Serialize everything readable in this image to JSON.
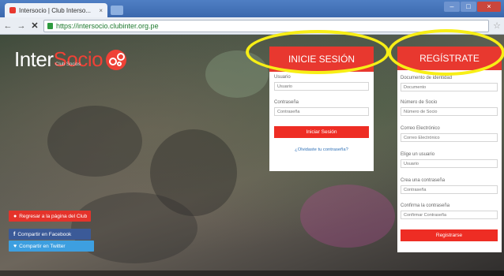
{
  "browser": {
    "tab_title": "Intersocio | Club Interso...",
    "tab_close": "×",
    "url": "https://intersocio.clubinter.org.pe",
    "win_minimize": "–",
    "win_maximize": "□",
    "win_close": "×"
  },
  "logo": {
    "text_a": "Inter",
    "text_b": "Socio",
    "subtitle": "Club Socios"
  },
  "side_buttons": {
    "club": "Regresar a la página del Club",
    "facebook": "Compartir en Facebook",
    "twitter": "Compartir en Twitter"
  },
  "login": {
    "title": "INICIE SESIÓN",
    "user_label": "Usuario",
    "user_placeholder": "Usuario",
    "password_label": "Contraseña",
    "password_placeholder": "Contraseña",
    "submit": "Iniciar Sesión",
    "forgot": "¿Olvidaste tu contraseña?"
  },
  "register": {
    "title": "REGÍSTRATE",
    "doc_label": "Documento de identidad",
    "doc_placeholder": "Documento",
    "socio_label": "Número de Socio",
    "socio_placeholder": "Número de Socio",
    "email_label": "Correo Electrónico",
    "email_placeholder": "Correo Electrónico",
    "user_label": "Elige un usuario",
    "user_placeholder": "Usuario",
    "pass_label": "Crea una contraseña",
    "pass_placeholder": "Contraseña",
    "confirm_label": "Confirma la contraseña",
    "confirm_placeholder": "Confirmar Contraseña",
    "submit": "Registrarse"
  },
  "colors": {
    "accent": "#e8382f",
    "highlight": "#f7ee16",
    "facebook": "#3b5a98",
    "twitter": "#3d9fe0"
  },
  "icons": {
    "back": "back-arrow-icon",
    "forward": "forward-arrow-icon",
    "stop": "stop-icon",
    "lock": "lock-icon",
    "star": "bookmark-star-icon"
  }
}
